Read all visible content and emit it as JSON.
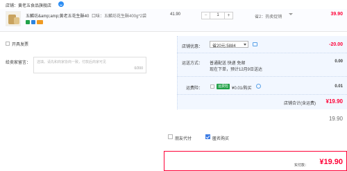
{
  "shop": {
    "label": "店铺：黄老五食品旗舰店"
  },
  "item": {
    "title": "五麟坊&amp;amp;黄老五花生酥40...",
    "sku": "口味：五麟坊花生酥400g*2袋",
    "unit_price": "41.90",
    "quantity": "1",
    "promo": "省2：热卖促销",
    "subtotal": "39.90"
  },
  "invoice": {
    "label": "开具发票"
  },
  "message": {
    "label": "给卖家留言：",
    "placeholder": "选填。请先和商家协商一致，付款后商家可见",
    "count": "0/200"
  },
  "shop_discount": {
    "label": "店铺优惠：",
    "selected": "省20元:5884",
    "amount": "-20.00"
  },
  "shipping": {
    "label": "运送方式：",
    "method": "普通配送 快递 免邮",
    "eta": "现在下单，预计12月9日送达",
    "fee": "0.00"
  },
  "insurance": {
    "label": "运费险：",
    "badge": "运费险",
    "text": "¥0.01/购买",
    "fee": "0.01"
  },
  "shop_total": {
    "label": "店铺合计(含运费)",
    "amount": "¥19.90"
  },
  "bottom": {
    "price_partial": "19.90",
    "options": [
      "朋友代付",
      "匿名购买"
    ],
    "pay_label": "实付款：",
    "pay_amount": "¥19.90"
  },
  "colors": {
    "accent_red": "#ff0036",
    "link_blue": "#3d7ce4",
    "panel_bg": "#f2f7ff"
  }
}
